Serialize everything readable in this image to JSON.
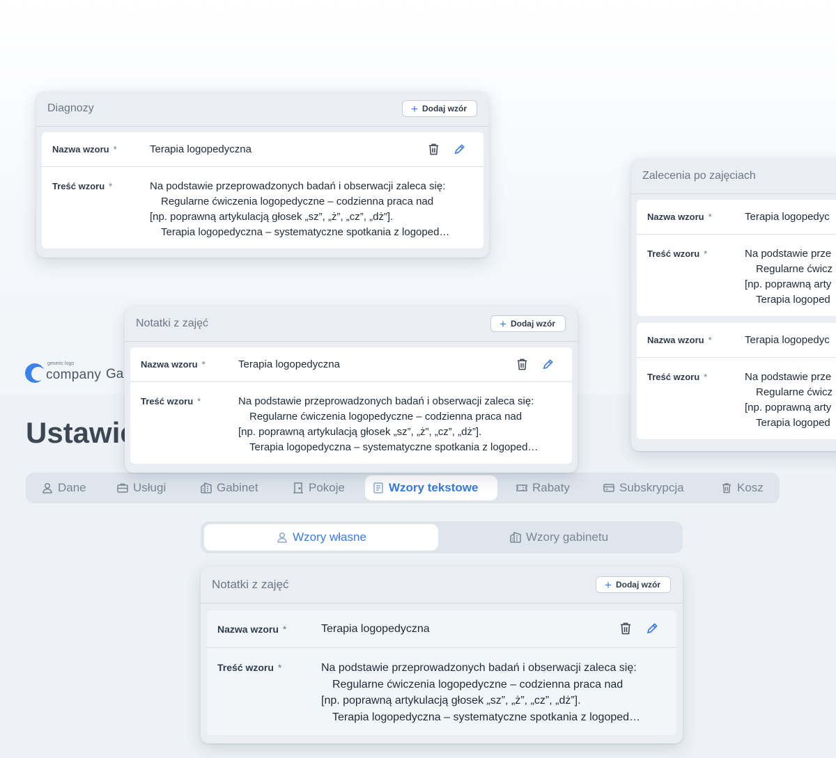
{
  "app": {
    "logo_small": "generic logo",
    "logo_text": "company",
    "name_partial": "Ga",
    "page_title_partial": "Ustawie"
  },
  "tabs": [
    {
      "label": "Dane",
      "icon": "user-icon"
    },
    {
      "label": "Usługi",
      "icon": "briefcase-icon"
    },
    {
      "label": "Gabinet",
      "icon": "building-icon"
    },
    {
      "label": "Pokoje",
      "icon": "door-icon"
    },
    {
      "label": "Wzory tekstowe",
      "icon": "document-icon",
      "active": true
    },
    {
      "label": "Rabaty",
      "icon": "ticket-icon"
    },
    {
      "label": "Subskrypcja",
      "icon": "card-icon"
    },
    {
      "label": "Kosz",
      "icon": "trash-icon"
    }
  ],
  "subtabs": [
    {
      "label": "Wzory własne",
      "icon": "user-icon",
      "active": true
    },
    {
      "label": "Wzory gabinetu",
      "icon": "building-icon"
    }
  ],
  "labels": {
    "add": "Dodaj wzór",
    "name_label": "Nazwa wzoru",
    "body_label": "Treść wzoru",
    "required": "*"
  },
  "cards": {
    "diagnozy": {
      "title": "Diagnozy",
      "entry": {
        "name": "Terapia logopedyczna",
        "lines": [
          "Na podstawie przeprowadzonych badań i obserwacji zaleca się:",
          "Regularne ćwiczenia logopedyczne – codzienna praca nad",
          "[np. poprawną artykulacją głosek „sz”, „ż”, „cz”, „dż”].",
          "Terapia logopedyczna – systematyczne spotkania z logoped…"
        ]
      }
    },
    "zalecenia": {
      "title": "Zalecenia po zajęciach",
      "entries": [
        {
          "name": "Terapia logopedyc",
          "lines": [
            "Na podstawie prze",
            "Regularne ćwicz",
            "[np. poprawną arty",
            "Terapia logoped"
          ]
        },
        {
          "name": "Terapia logopedyc",
          "lines": [
            "Na podstawie prze",
            "Regularne ćwicz",
            "[np. poprawną arty",
            "Terapia logoped"
          ]
        }
      ]
    },
    "notatki_floating": {
      "title": "Notatki z zajęć",
      "entry": {
        "name": "Terapia logopedyczna",
        "lines": [
          "Na podstawie przeprowadzonych badań i obserwacji zaleca się:",
          "Regularne ćwiczenia logopedyczne – codzienna praca nad",
          "[np. poprawną artykulacją głosek „sz”, „ż”, „cz”, „dż”].",
          "Terapia logopedyczna – systematyczne spotkania z logoped…"
        ]
      }
    },
    "notatki_main": {
      "title": "Notatki z zajęć",
      "entry": {
        "name": "Terapia logopedyczna",
        "lines": [
          "Na podstawie przeprowadzonych badań i obserwacji zaleca się:",
          "Regularne ćwiczenia logopedyczne – codzienna praca nad",
          "[np. poprawną artykulacją głosek „sz”, „ż”, „cz”, „dż”].",
          "Terapia logopedyczna – systematyczne spotkania z logoped…"
        ]
      }
    }
  },
  "colors": {
    "accent": "#3a7bd5",
    "tab_bg": "#dfe5ec",
    "card_bg": "#eaeef3"
  }
}
